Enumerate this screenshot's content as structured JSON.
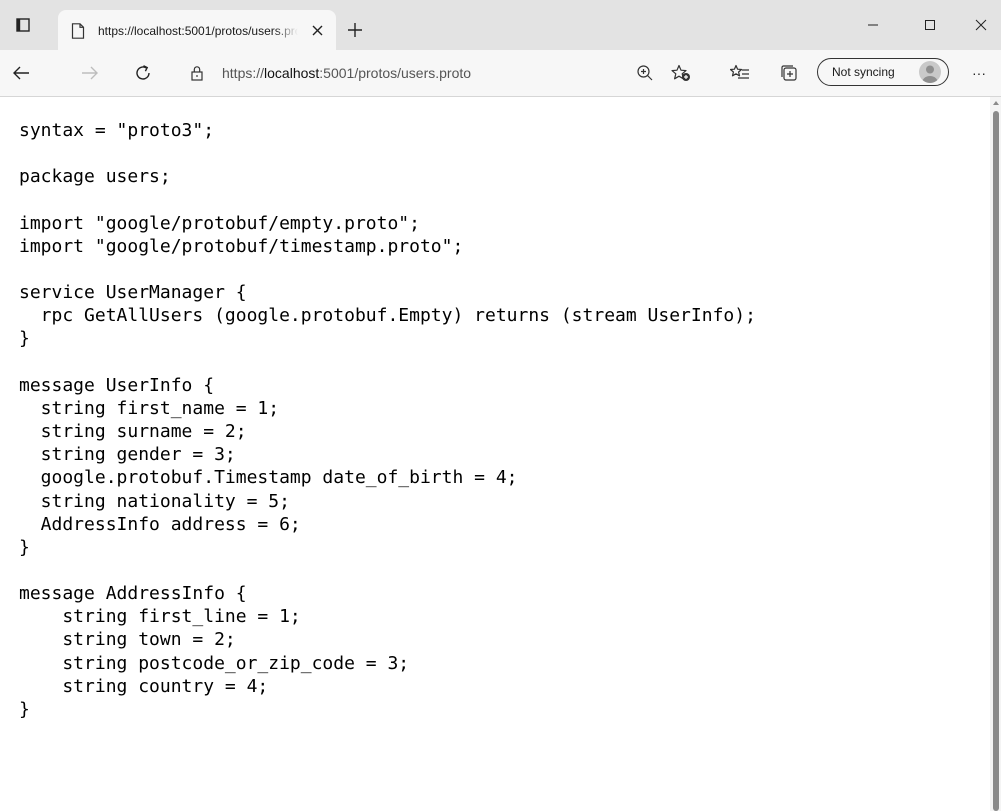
{
  "tab": {
    "title": "https://localhost:5001/protos/users.proto",
    "close_icon": "close-icon"
  },
  "window": {
    "minimize_icon": "minimize-icon",
    "maximize_icon": "maximize-icon",
    "close_icon": "window-close-icon"
  },
  "toolbar": {
    "url_prefix": "https://",
    "url_host": "localhost",
    "url_rest": ":5001/protos/users.proto",
    "sync_label": "Not syncing",
    "menu_label": "···"
  },
  "colors": {
    "tabstrip_bg": "#e3e3e3",
    "toolbar_bg": "#f7f7f7",
    "text": "#000000"
  },
  "document": {
    "lines": [
      "syntax = \"proto3\";",
      "",
      "package users;",
      "",
      "import \"google/protobuf/empty.proto\";",
      "import \"google/protobuf/timestamp.proto\";",
      "",
      "service UserManager {",
      "  rpc GetAllUsers (google.protobuf.Empty) returns (stream UserInfo);",
      "}",
      "",
      "message UserInfo {",
      "  string first_name = 1;",
      "  string surname = 2;",
      "  string gender = 3;",
      "  google.protobuf.Timestamp date_of_birth = 4;",
      "  string nationality = 5;",
      "  AddressInfo address = 6;",
      "}",
      "",
      "message AddressInfo {",
      "    string first_line = 1;",
      "    string town = 2;",
      "    string postcode_or_zip_code = 3;",
      "    string country = 4;",
      "}"
    ]
  }
}
